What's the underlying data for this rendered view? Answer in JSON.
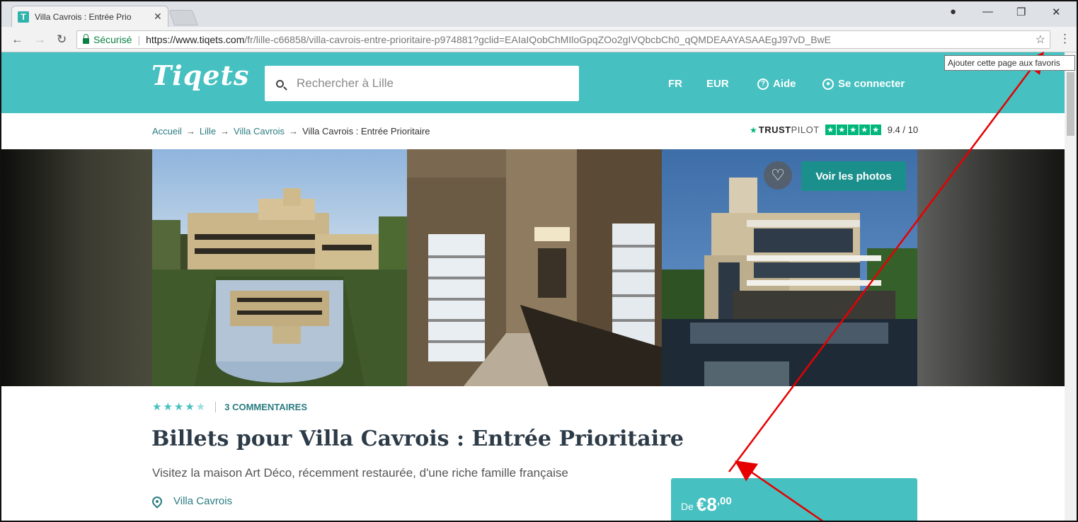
{
  "browser": {
    "tab_title": "Villa Cavrois : Entrée Prio",
    "tab_favicon": "T",
    "secure_label": "Sécurisé",
    "url_host": "https://www.tiqets.com",
    "url_path": "/fr/lille-c66858/villa-cavrois-entre-prioritaire-p974881?gclid=EAIaIQobChMIloGpqZOo2gIVQbcbCh0_qQMDEAAYASAAEgJ97vD_BwE",
    "bookmark_tooltip": "Ajouter cette page aux favoris"
  },
  "header": {
    "logo": "Tiqets",
    "search_placeholder": "Rechercher à Lille",
    "lang": "FR",
    "currency": "EUR",
    "help": "Aide",
    "login": "Se connecter"
  },
  "breadcrumb": {
    "items": [
      "Accueil",
      "Lille",
      "Villa Cavrois"
    ],
    "current": "Villa Cavrois : Entrée Prioritaire"
  },
  "trustpilot": {
    "brand_strong": "TRUST",
    "brand_light": "PILOT",
    "score": "9.4 / 10"
  },
  "gallery": {
    "view_photos": "Voir les photos"
  },
  "product": {
    "rating": 4.5,
    "reviews": "3 COMMENTAIRES",
    "title": "Billets pour Villa Cavrois : Entrée Prioritaire",
    "subtitle": "Visitez la maison Art Déco, récemment restaurée, d'une riche famille française",
    "location": "Villa Cavrois",
    "price_from": "De",
    "price_main": "€8",
    "price_cents": ",00"
  },
  "colors": {
    "brand": "#46c0c0",
    "brand_dark": "#1b8f8c",
    "annotation_arrow": "#e60000"
  }
}
